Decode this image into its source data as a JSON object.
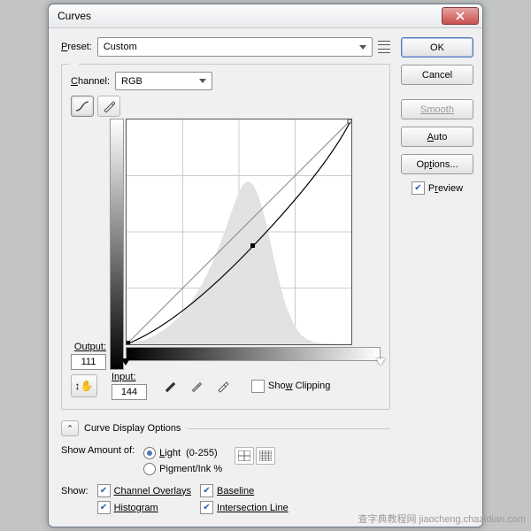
{
  "dialog": {
    "title": "Curves"
  },
  "preset": {
    "label": "Preset:",
    "value": "Custom"
  },
  "channel": {
    "label": "Channel:",
    "value": "RGB"
  },
  "output": {
    "label": "Output:",
    "value": "111"
  },
  "input": {
    "label": "Input:",
    "value": "144"
  },
  "showClipping": {
    "label": "Show Clipping",
    "checked": false
  },
  "displayOptions": {
    "label": "Curve Display Options"
  },
  "showAmount": {
    "label": "Show Amount of:",
    "light": "Light  (0-255)",
    "pigment": "Pigment/Ink %",
    "selected": "light"
  },
  "show": {
    "label": "Show:",
    "channelOverlays": {
      "label": "Channel Overlays",
      "checked": true
    },
    "histogram": {
      "label": "Histogram",
      "checked": true
    },
    "baseline": {
      "label": "Baseline",
      "checked": true
    },
    "intersection": {
      "label": "Intersection Line",
      "checked": true
    }
  },
  "buttons": {
    "ok": "OK",
    "cancel": "Cancel",
    "smooth": "Smooth",
    "auto": "Auto",
    "options": "Options..."
  },
  "preview": {
    "label": "Preview",
    "checked": true
  },
  "watermark": "查字典教程网 jiaocheng.chazidian.com",
  "chart_data": {
    "type": "line",
    "title": "Curves",
    "xlabel": "Input",
    "ylabel": "Output",
    "xlim": [
      0,
      255
    ],
    "ylim": [
      0,
      255
    ],
    "series": [
      {
        "name": "baseline",
        "x": [
          0,
          255
        ],
        "y": [
          0,
          255
        ]
      },
      {
        "name": "curve",
        "x": [
          0,
          64,
          144,
          200,
          255
        ],
        "y": [
          0,
          36,
          111,
          185,
          255
        ]
      }
    ],
    "control_point": {
      "input": 144,
      "output": 111
    },
    "histogram": [
      0,
      0,
      0,
      1,
      1,
      1,
      2,
      2,
      2,
      3,
      3,
      4,
      4,
      5,
      5,
      6,
      7,
      8,
      9,
      10,
      11,
      12,
      13,
      14,
      16,
      17,
      18,
      20,
      21,
      23,
      24,
      26,
      28,
      30,
      32,
      34,
      36,
      38,
      40,
      43,
      45,
      48,
      51,
      54,
      57,
      60,
      64,
      67,
      71,
      75,
      79,
      83,
      88,
      92,
      97,
      102,
      108,
      113,
      119,
      125,
      132,
      138,
      145,
      152,
      159,
      165,
      170,
      174,
      176,
      177,
      176,
      174,
      170,
      165,
      158,
      150,
      141,
      131,
      120,
      108,
      96,
      84,
      72,
      61,
      50,
      41,
      33,
      26,
      20,
      15,
      11,
      8,
      6,
      4,
      3,
      2,
      2,
      1,
      1,
      0
    ]
  }
}
